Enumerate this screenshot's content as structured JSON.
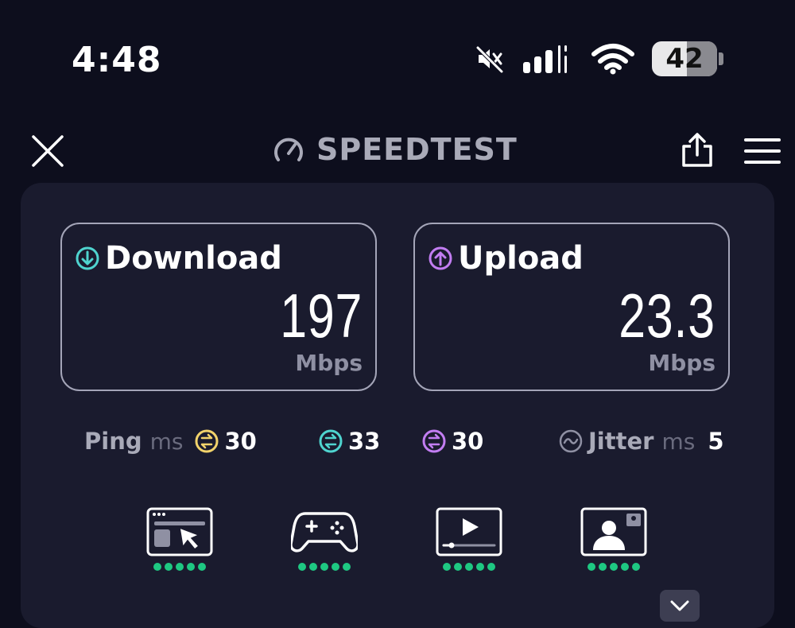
{
  "status_bar": {
    "time": "4:48",
    "battery_level": "42",
    "icons": [
      "silent-mode-icon",
      "cellular-signal-icon",
      "wifi-icon",
      "battery-icon"
    ]
  },
  "header": {
    "brand": "SPEEDTEST",
    "icons": [
      "close-icon",
      "speedometer-icon",
      "share-icon",
      "menu-icon"
    ]
  },
  "download": {
    "label": "Download",
    "value": "197",
    "unit": "Mbps",
    "color": "#4fd4cf"
  },
  "upload": {
    "label": "Upload",
    "value": "23.3",
    "unit": "Mbps",
    "color": "#c27df2"
  },
  "ping": {
    "label": "Ping",
    "unit": "ms",
    "idle": "30",
    "download": "33",
    "upload": "30",
    "idle_color": "#f2d36b",
    "download_color": "#4fd4cf",
    "upload_color": "#c27df2"
  },
  "jitter": {
    "label": "Jitter",
    "unit": "ms",
    "value": "5"
  },
  "experience": [
    {
      "icon": "web-browsing-icon",
      "rating": 5
    },
    {
      "icon": "gaming-controller-icon",
      "rating": 5
    },
    {
      "icon": "video-streaming-icon",
      "rating": 5
    },
    {
      "icon": "video-call-icon",
      "rating": 5
    }
  ],
  "colors": {
    "rating_dot": "#1ec882",
    "background": "#0d0e1d",
    "card": "#1a1b2e"
  }
}
